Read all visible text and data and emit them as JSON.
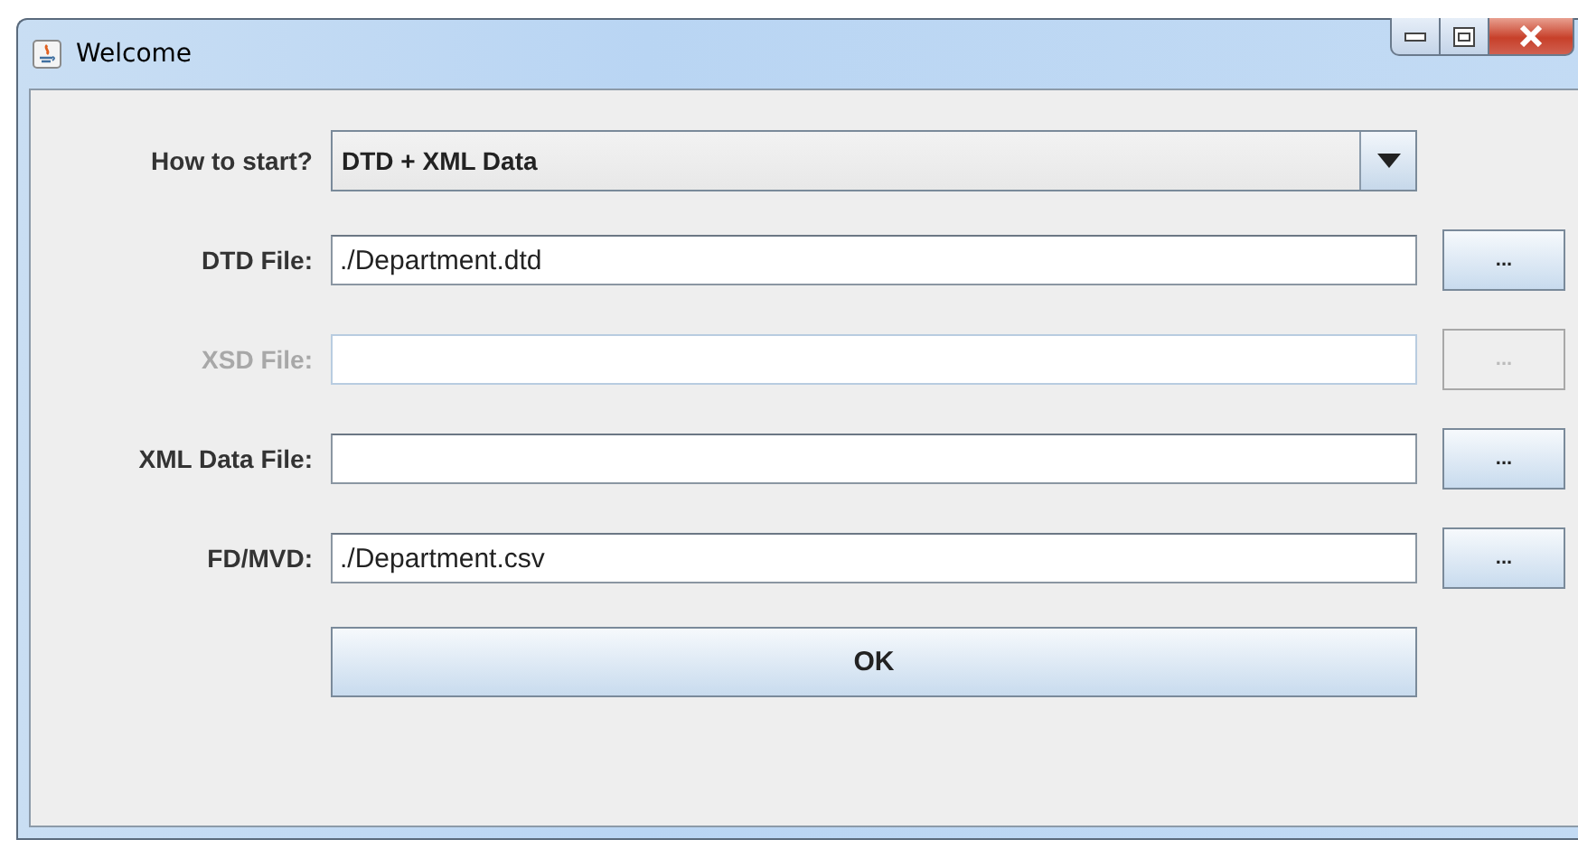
{
  "window": {
    "title": "Welcome"
  },
  "start": {
    "label": "How to start?",
    "value": "DTD + XML Data"
  },
  "file_rows": [
    {
      "label": "DTD File:",
      "value": "./Department.dtd",
      "disabled": false,
      "button": "..."
    },
    {
      "label": "XSD File:",
      "disabled": true,
      "button": "..."
    },
    {
      "label": "XML Data File:",
      "disabled": false,
      "button": "..."
    },
    {
      "label": "FD/MVD:",
      "value": "./Department.csv",
      "disabled": false,
      "button": "..."
    }
  ],
  "ok_button": "OK"
}
